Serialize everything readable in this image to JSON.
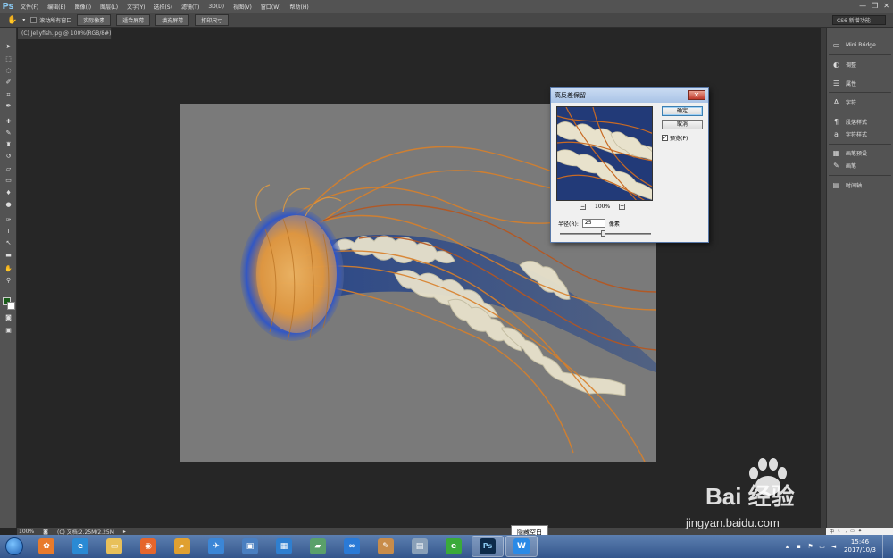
{
  "app": {
    "logo": "Ps",
    "menus": [
      "文件(F)",
      "编辑(E)",
      "图像(I)",
      "图层(L)",
      "文字(Y)",
      "选择(S)",
      "滤镜(T)",
      "3D(D)",
      "视图(V)",
      "窗口(W)",
      "帮助(H)"
    ],
    "window_controls": [
      "—",
      "❐",
      "✕"
    ]
  },
  "options_bar": {
    "scroll_all_label": "滚动所有窗口",
    "buttons": [
      "实际像素",
      "适合屏幕",
      "填充屏幕",
      "打印尺寸"
    ],
    "workspace": "CS6 新增功能"
  },
  "document": {
    "tab_title": "(C) Jellyfish.jpg @ 100%(RGB/8#)"
  },
  "right_panel": {
    "items": [
      {
        "icon": "mini-bridge-icon",
        "label": "Mini Bridge"
      },
      {
        "icon": "adjustments-icon",
        "label": "调整"
      },
      {
        "icon": "properties-icon",
        "label": "属性"
      },
      {
        "icon": "character-icon",
        "label": "字符"
      },
      {
        "icon": "paragraph-styles-icon",
        "label": "段落样式"
      },
      {
        "icon": "character-styles-icon",
        "label": "字符样式"
      },
      {
        "icon": "brush-presets-icon",
        "label": "画笔预设"
      },
      {
        "icon": "brush-icon",
        "label": "画笔"
      },
      {
        "icon": "timeline-icon",
        "label": "时间轴"
      }
    ]
  },
  "status_bar": {
    "zoom": "100%",
    "doc_info": "(C) 文档:2.25M/2.25M"
  },
  "dialog": {
    "title": "高反差保留",
    "ok_label": "确定",
    "cancel_label": "取消",
    "preview_label": "预览(P)",
    "preview_checked": true,
    "zoom_level": "100%",
    "radius_label": "半径(R):",
    "radius_value": "25",
    "radius_unit": "像素",
    "slider_level": 0.47
  },
  "taskbar": {
    "tooltip": "隐藏空白",
    "time": "15:46",
    "date": "2017/10/3",
    "apps": [
      {
        "icon": "colorful-pinwheel-icon",
        "color": "#e87b2c",
        "glyph": "✿"
      },
      {
        "icon": "ie-icon",
        "color": "#2a8ad4",
        "glyph": "e"
      },
      {
        "icon": "folder-icon",
        "color": "#e8c05a",
        "glyph": "▭"
      },
      {
        "icon": "firefox-icon",
        "color": "#e5662c",
        "glyph": "◉"
      },
      {
        "icon": "search-app-icon",
        "color": "#e0a030",
        "glyph": "⌕"
      },
      {
        "icon": "bird-app-icon",
        "color": "#3b86d6",
        "glyph": "✈"
      },
      {
        "icon": "remote-desktop-icon",
        "color": "#4a7fc0",
        "glyph": "▣"
      },
      {
        "icon": "grid-app-icon",
        "color": "#2f7fd0",
        "glyph": "▦"
      },
      {
        "icon": "green-book-icon",
        "color": "#5aa06a",
        "glyph": "▰"
      },
      {
        "icon": "cloud-app-icon",
        "color": "#2a7ad6",
        "glyph": "∞"
      },
      {
        "icon": "paint-icon",
        "color": "#c88c4a",
        "glyph": "✎"
      },
      {
        "icon": "calculator-icon",
        "color": "#8aa0b8",
        "glyph": "▤"
      },
      {
        "icon": "green-e-icon",
        "color": "#3aaa3a",
        "glyph": "e"
      },
      {
        "icon": "photoshop-icon",
        "color": "#0c2a4a",
        "glyph": "Ps"
      },
      {
        "icon": "wps-icon",
        "color": "#2a8ae6",
        "glyph": "W"
      }
    ]
  },
  "watermark": {
    "brand": "Bai 经验",
    "url": "jingyan.baidu.com"
  },
  "colors": {
    "ps_bg": "#262626",
    "panel": "#535353",
    "dialog_title": "#a9c3e6",
    "accent_orange": "#e08a2a"
  }
}
